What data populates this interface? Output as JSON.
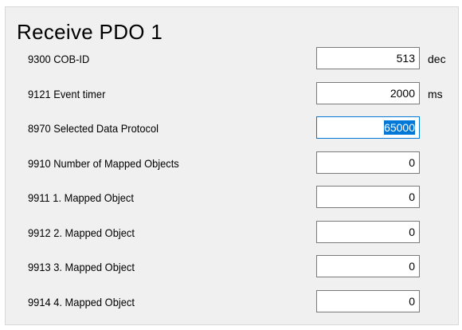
{
  "panel": {
    "title": "Receive PDO 1"
  },
  "rows": [
    {
      "label": "9300 COB-ID",
      "value": "513",
      "unit": "dec"
    },
    {
      "label": "9121 Event timer",
      "value": "2000",
      "unit": "ms"
    },
    {
      "label": "8970 Selected Data Protocol",
      "value": "65000",
      "unit": ""
    },
    {
      "label": "9910 Number of Mapped Objects",
      "value": "0",
      "unit": ""
    },
    {
      "label": "9911 1. Mapped Object",
      "value": "0",
      "unit": ""
    },
    {
      "label": "9912 2. Mapped Object",
      "value": "0",
      "unit": ""
    },
    {
      "label": "9913 3. Mapped Object",
      "value": "0",
      "unit": ""
    },
    {
      "label": "9914 4. Mapped Object",
      "value": "0",
      "unit": ""
    }
  ],
  "colors": {
    "panel_bg": "#f0f0f0",
    "selection": "#0078d7"
  }
}
